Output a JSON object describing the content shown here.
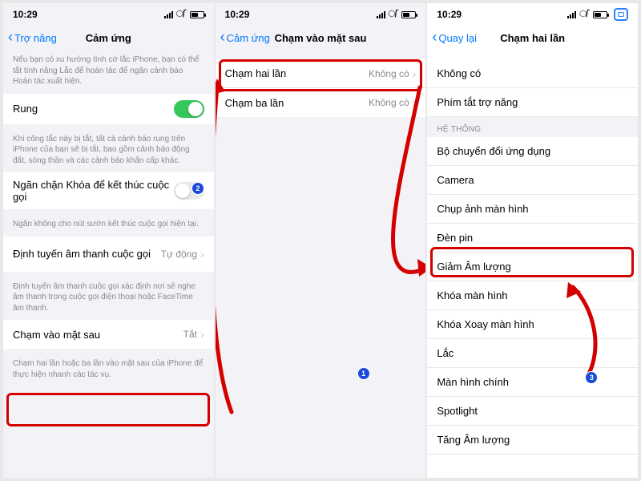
{
  "status": {
    "time": "10:29"
  },
  "phone1": {
    "back": "Trợ năng",
    "title": "Cảm ứng",
    "intro": "Nếu bạn có xu hướng tình cờ lắc iPhone, bạn có thể tắt tính năng Lắc để hoàn tác để ngăn cảnh báo Hoàn tác xuất hiện.",
    "rung": "Rung",
    "rung_note": "Khi công tắc này bị tắt, tất cả cảnh báo rung trên iPhone của bạn sẽ bị tắt, bao gồm cảnh báo động đất, sóng thần và các cảnh báo khẩn cấp khác.",
    "lock_end_call": "Ngăn chặn Khóa để kết thúc cuộc gọi",
    "lock_note": "Ngăn không cho nút sườn kết thúc cuộc gọi hiện tại.",
    "audio_routing": "Định tuyến âm thanh cuộc gọi",
    "audio_value": "Tự động",
    "audio_note": "Định tuyến âm thanh cuộc gọi xác định nơi sẽ nghe âm thanh trong cuộc gọi điện thoại hoặc FaceTime âm thanh.",
    "back_tap": "Chạm vào mặt sau",
    "back_tap_value": "Tắt",
    "back_tap_note": "Chạm hai lần hoặc ba lần vào mặt sau của iPhone để thực hiện nhanh các tác vụ.",
    "badge2": "2"
  },
  "phone2": {
    "back": "Cảm ứng",
    "title": "Chạm vào mặt sau",
    "double": "Chạm hai lần",
    "triple": "Chạm ba lần",
    "none": "Không có",
    "badge1": "1"
  },
  "phone3": {
    "back": "Quay lại",
    "title": "Chạm hai lần",
    "none": "Không có",
    "acc_shortcut": "Phím tắt trợ năng",
    "section_system": "HỆ THỐNG",
    "items": {
      "app_switcher": "Bộ chuyển đổi ứng dụng",
      "camera": "Camera",
      "screenshot": "Chụp ảnh màn hình",
      "flashlight": "Đèn pin",
      "vol_down": "Giảm Âm lượng",
      "lock": "Khóa màn hình",
      "rot_lock": "Khóa Xoay màn hình",
      "shake": "Lắc",
      "home": "Màn hình chính",
      "spotlight": "Spotlight",
      "vol_up": "Tăng Âm lượng"
    },
    "badge3": "3"
  }
}
